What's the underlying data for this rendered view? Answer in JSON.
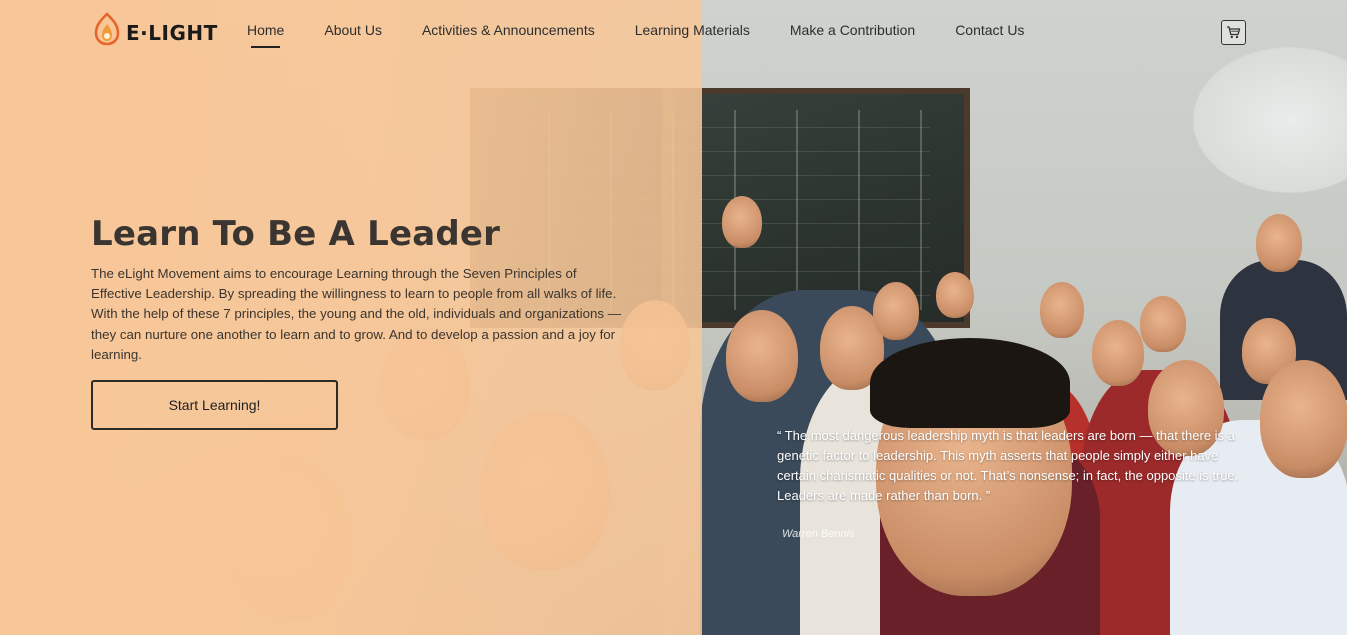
{
  "brand": {
    "logo_text": "E·LIGHT",
    "accent": "#e8652a",
    "overlay_color": "#f8c798"
  },
  "nav": {
    "items": [
      {
        "label": "Home",
        "active": true
      },
      {
        "label": "About Us",
        "active": false
      },
      {
        "label": "Activities & Announcements",
        "active": false
      },
      {
        "label": "Learning Materials",
        "active": false
      },
      {
        "label": "Make a Contribution",
        "active": false
      },
      {
        "label": "Contact Us",
        "active": false
      }
    ],
    "cart_icon": "cart-icon"
  },
  "hero": {
    "title": "Learn To Be A Leader",
    "description": "The eLight Movement aims to encourage Learning through the Seven Principles of Effective Leadership. By spreading the willingness to learn to people from all walks of life. With the help of these 7 principles, the young and the old, individuals and organizations — they can nurture one another to learn and to grow. And to develop a passion and a joy for learning.",
    "cta_label": "Start Learning!"
  },
  "quote": {
    "text": "“ The most dangerous leadership myth is that leaders are born — that there is a genetic factor to leadership. This myth asserts that people simply either have certain charismatic qualities or not. That’s nonsense; in fact, the opposite is true. Leaders are made rather than born. ”",
    "author": "Warren Bennis"
  }
}
